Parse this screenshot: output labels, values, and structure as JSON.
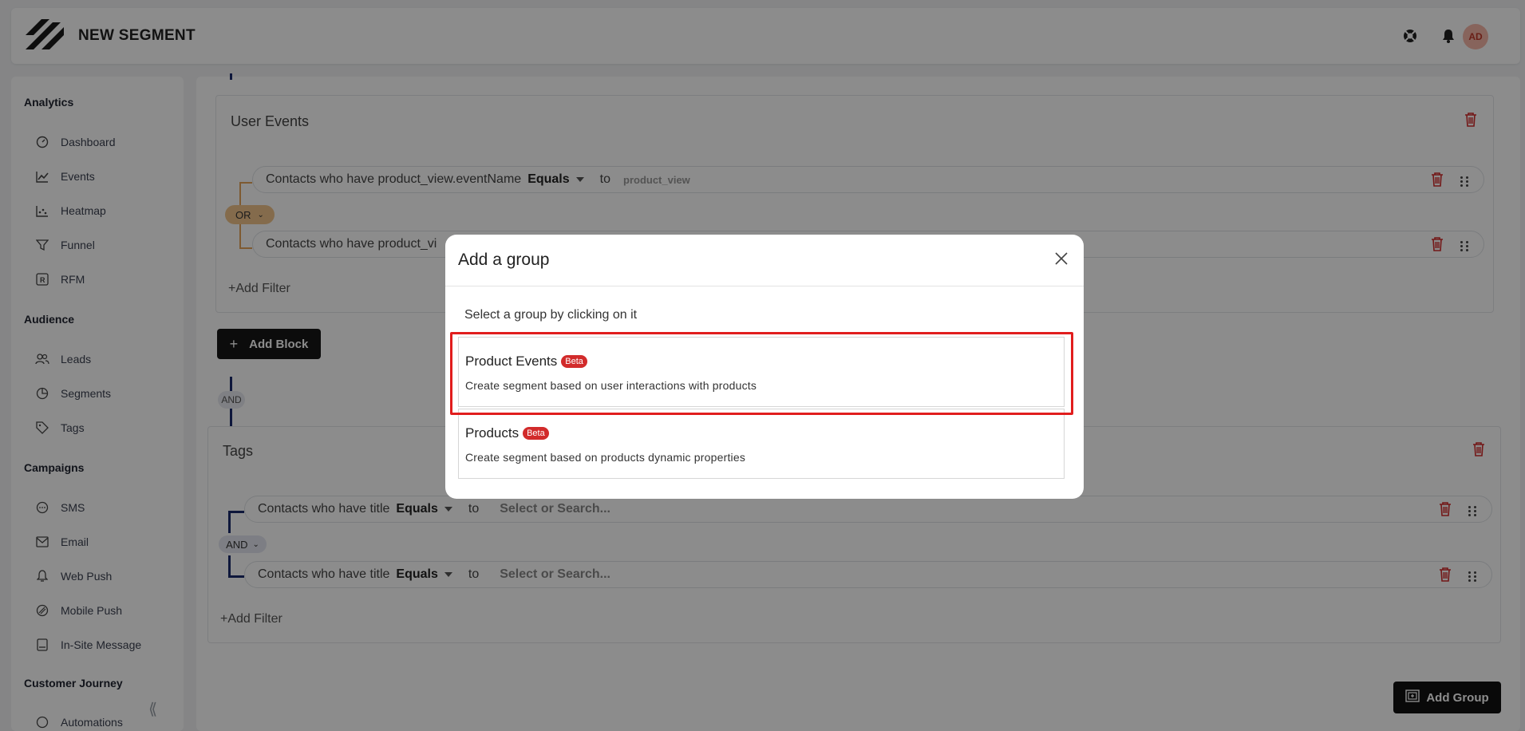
{
  "header": {
    "title": "NEW SEGMENT",
    "avatar_initials": "AD",
    "icons": [
      "lifebuoy-icon",
      "bell-icon"
    ]
  },
  "sidebar": {
    "sections": [
      {
        "label": "Analytics"
      },
      {
        "label": "Audience"
      },
      {
        "label": "Campaigns"
      },
      {
        "label": "Customer Journey"
      }
    ],
    "items": [
      {
        "label": "Dashboard",
        "icon": "dashboard-icon"
      },
      {
        "label": "Events",
        "icon": "line-chart-icon"
      },
      {
        "label": "Heatmap",
        "icon": "heatmap-icon"
      },
      {
        "label": "Funnel",
        "icon": "funnel-icon"
      },
      {
        "label": "RFM",
        "icon": "rfm-icon"
      },
      {
        "label": "Leads",
        "icon": "users-icon"
      },
      {
        "label": "Segments",
        "icon": "pie-icon"
      },
      {
        "label": "Tags",
        "icon": "tag-icon"
      },
      {
        "label": "SMS",
        "icon": "sms-icon"
      },
      {
        "label": "Email",
        "icon": "mail-icon"
      },
      {
        "label": "Web Push",
        "icon": "bell-icon"
      },
      {
        "label": "Mobile Push",
        "icon": "mobile-push-icon"
      },
      {
        "label": "In-Site Message",
        "icon": "insite-icon"
      },
      {
        "label": "Automations",
        "icon": "automation-icon"
      }
    ]
  },
  "main": {
    "user_events_block": {
      "title": "User Events",
      "filters": [
        {
          "text": "Contacts who have product_view.eventName",
          "operator": "Equals",
          "to": "to",
          "value": "product_view"
        },
        {
          "text": "Contacts who have product_vi"
        }
      ],
      "logic": "OR",
      "add_filter": "Add Filter"
    },
    "add_block": "Add Block",
    "and_connector": "AND",
    "tags_block": {
      "title": "Tags",
      "filters": [
        {
          "text": "Contacts who have title",
          "operator": "Equals",
          "to": "to",
          "placeholder": "Select or Search..."
        },
        {
          "text": "Contacts who have title",
          "operator": "Equals",
          "to": "to",
          "placeholder": "Select or Search..."
        }
      ],
      "logic": "AND",
      "add_filter": "Add Filter"
    },
    "add_group": "Add Group"
  },
  "modal": {
    "title": "Add a group",
    "subtitle": "Select a group by clicking on it",
    "options": [
      {
        "title": "Product Events",
        "badge": "Beta",
        "description": "Create segment based on user interactions with products"
      },
      {
        "title": "Products",
        "badge": "Beta",
        "description": "Create segment based on products dynamic properties"
      }
    ]
  },
  "colors": {
    "accent_dark": "#161616",
    "danger": "#d22b2b",
    "connector": "#1a2a6c",
    "or_pill": "#f0c48a",
    "highlight": "#e11d1d"
  }
}
